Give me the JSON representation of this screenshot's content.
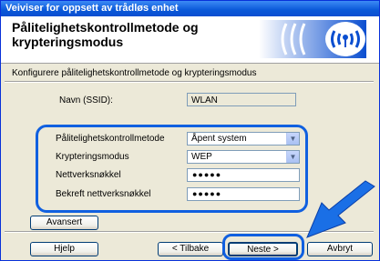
{
  "window": {
    "title": "Veiviser for oppsett av trådløs enhet"
  },
  "header": {
    "title_line1": "Pålitelighetskontrollmetode og",
    "title_line2": "krypteringsmodus"
  },
  "subtitle": "Konfigurere pålitelighetskontrollmetode og krypteringsmodus",
  "ssid": {
    "label": "Navn (SSID):",
    "value": "WLAN"
  },
  "form": {
    "auth_label": "Pålitelighetskontrollmetode",
    "auth_value": "Åpent system",
    "enc_label": "Krypteringsmodus",
    "enc_value": "WEP",
    "key_label": "Nettverksnøkkel",
    "key_value": "●●●●●",
    "confirm_label": "Bekreft nettverksnøkkel",
    "confirm_value": "●●●●●"
  },
  "buttons": {
    "advanced": "Avansert",
    "help": "Hjelp",
    "back": "< Tilbake",
    "next": "Neste >",
    "cancel": "Avbryt"
  },
  "colors": {
    "highlight": "#1060e0",
    "titlebar": "#0a58d8"
  }
}
